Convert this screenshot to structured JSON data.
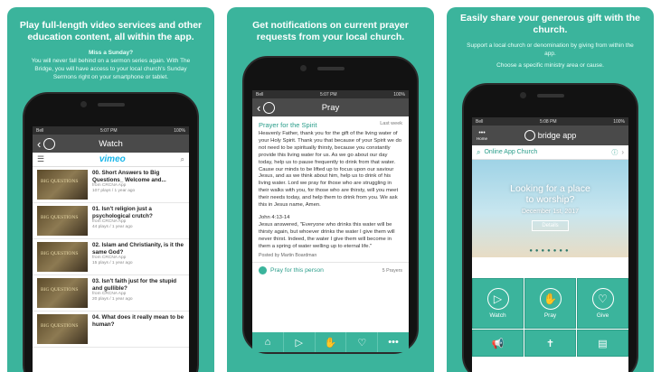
{
  "panel1": {
    "caption": "Play full-length video services and other education content, all within the app.",
    "sub_heading": "Miss a Sunday?",
    "sub_text": "You will never fall behind on a sermon series again. With The Bridge, you will have access to your local church's Sunday Sermons right on your smartphone or tablet.",
    "status": {
      "carrier": "Bell",
      "time": "5:07 PM",
      "battery": "100%"
    },
    "nav_title": "Watch",
    "brand": "vimeo",
    "videos": [
      {
        "title": "00. Short Answers to Big Questions_ Welcome and...",
        "source": "from CRCNA App",
        "meta": "107 plays / 1 year ago",
        "thumb_text": "BIG QUESTIONS"
      },
      {
        "title": "01. Isn't religion just a psychological crutch?",
        "source": "from CRCNA App",
        "meta": "44 plays / 1 year ago",
        "thumb_text": "BIG QUESTIONS"
      },
      {
        "title": "02. Islam and Christianity, is it the same God?",
        "source": "from CRCNA App",
        "meta": "15 plays / 1 year ago",
        "thumb_text": "BIG QUESTIONS"
      },
      {
        "title": "03. Isn't faith just for the stupid and gullible?",
        "source": "from CRCNA App",
        "meta": "20 plays / 1 year ago",
        "thumb_text": "BIG QUESTIONS"
      },
      {
        "title": "04. What does it really mean to be human?",
        "source": "",
        "meta": "",
        "thumb_text": "BIG QUESTIONS"
      }
    ]
  },
  "panel2": {
    "caption": "Get notifications on current prayer requests from your local church.",
    "nav_title": "Pray",
    "prayer_title": "Prayer for the Spirit",
    "prayer_date": "Last week",
    "body": "Heavenly Father, thank you for the gift of the living water of your Holy Spirit. Thank you that because of your Spirit we do not need to be spiritually thirsty, because you constantly provide this living water for us. As we go about our day today, help us to pause frequently to drink from that water. Cause our minds to be lifted up to focus upon our saviour Jesus, and as we think about him, help us to drink of his living water. Lord we pray for those who are struggling in their walks with you, for those who are thirsty, will you meet their needs today, and help them to drink from you. We ask this in Jesus name, Amen.",
    "verse_ref": "John 4:13-14",
    "verse": "Jesus answered, \"Everyone who drinks this water will be thirsty again, but whoever drinks the water I give them will never thirst. Indeed, the water I give them will become in them a spring of water welling up to eternal life.\"",
    "posted_by": "Posted by Martin Boardman",
    "pray_label": "Pray for this person",
    "prayer_count": "5 Prayers"
  },
  "panel3": {
    "caption": "Easily share your generous gift with the church.",
    "sub1": "Support a local church or denomination by giving from within the app.",
    "sub2": "Choose a specific ministry area or cause.",
    "status": {
      "time": "5:08 PM",
      "battery": "100%"
    },
    "home_label": "Home",
    "app_name": "bridge app",
    "search_value": "Online App Church",
    "hero_line1": "Looking for a place",
    "hero_line2": "to worship?",
    "hero_date": "December 1st, 2017",
    "hero_button": "Details",
    "tiles": [
      {
        "label": "Watch",
        "icon": "play-icon"
      },
      {
        "label": "Pray",
        "icon": "praying-hands-icon"
      },
      {
        "label": "Give",
        "icon": "heart-icon"
      }
    ]
  },
  "colors": {
    "brand": "#3bb49c",
    "bar": "#4a4a4a",
    "link": "#2a9d8a",
    "vimeo": "#1ab7ea"
  }
}
